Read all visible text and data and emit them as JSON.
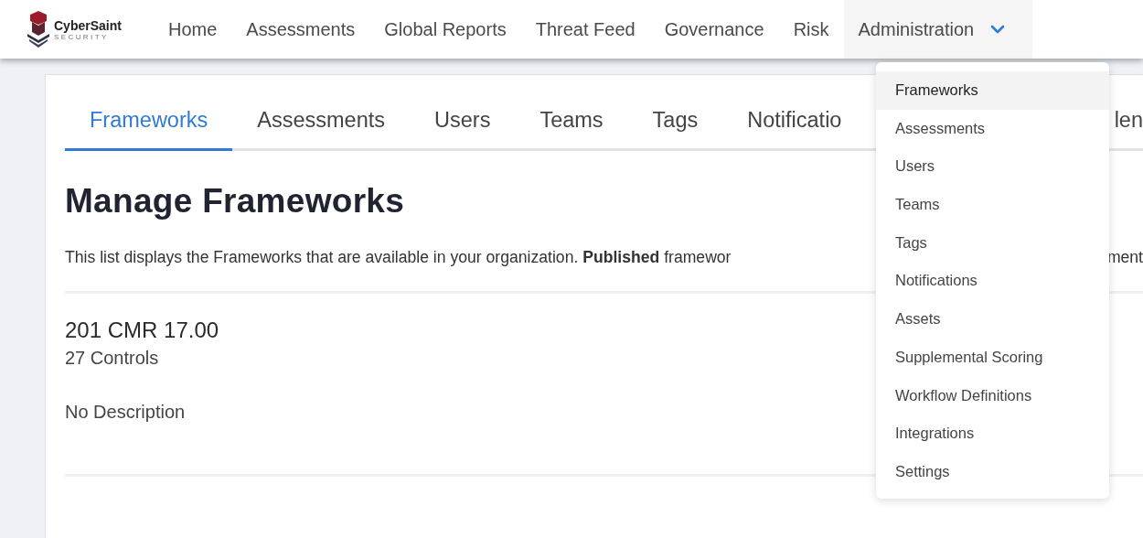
{
  "brand": {
    "name": "CyberSaint",
    "tagline": "SECURITY"
  },
  "nav": [
    {
      "label": "Home",
      "selected": false,
      "has_menu": false
    },
    {
      "label": "Assessments",
      "selected": false,
      "has_menu": false
    },
    {
      "label": "Global Reports",
      "selected": false,
      "has_menu": false
    },
    {
      "label": "Threat Feed",
      "selected": false,
      "has_menu": false
    },
    {
      "label": "Governance",
      "selected": false,
      "has_menu": false
    },
    {
      "label": "Risk",
      "selected": false,
      "has_menu": false
    },
    {
      "label": "Administration",
      "selected": true,
      "has_menu": true
    }
  ],
  "dropdown": [
    {
      "label": "Frameworks",
      "selected": true
    },
    {
      "label": "Assessments",
      "selected": false
    },
    {
      "label": "Users",
      "selected": false
    },
    {
      "label": "Teams",
      "selected": false
    },
    {
      "label": "Tags",
      "selected": false
    },
    {
      "label": "Notifications",
      "selected": false
    },
    {
      "label": "Assets",
      "selected": false
    },
    {
      "label": "Supplemental Scoring",
      "selected": false
    },
    {
      "label": "Workflow Definitions",
      "selected": false
    },
    {
      "label": "Integrations",
      "selected": false
    },
    {
      "label": "Settings",
      "selected": false
    }
  ],
  "tabs": [
    {
      "label": "Frameworks",
      "selected": true
    },
    {
      "label": "Assessments",
      "selected": false
    },
    {
      "label": "Users",
      "selected": false
    },
    {
      "label": "Teams",
      "selected": false
    },
    {
      "label": "Tags",
      "selected": false
    },
    {
      "label": "Notificatio",
      "selected": false
    },
    {
      "label": "len",
      "selected": false
    }
  ],
  "heading": "Manage Frameworks",
  "description": [
    "This list displays the Frameworks that are available in your organization. **Published** framewor",
    "ment"
  ],
  "frameworks": [
    {
      "title": "201 CMR 17.00",
      "controls": "27 Controls",
      "description": "No Description"
    }
  ]
}
